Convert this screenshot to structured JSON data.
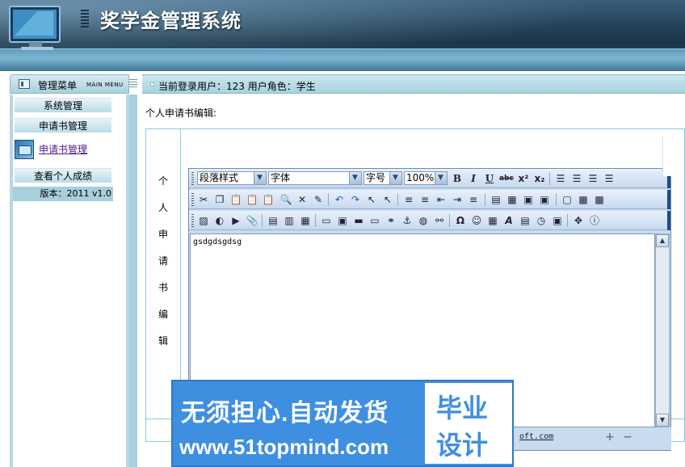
{
  "app": {
    "title": "奖学金管理系统"
  },
  "menu": {
    "title": "管理菜单",
    "title_en": "MAIN MENU"
  },
  "status": {
    "text": "当前登录用户：123   用户角色：学生"
  },
  "sidebar": {
    "items": [
      {
        "label": "系统管理"
      },
      {
        "label": "申请书管理"
      },
      {
        "label": "申请书管理"
      },
      {
        "label": "查看个人成绩"
      }
    ],
    "version": "版本：2011 v1.0"
  },
  "main": {
    "section_title": "个人申请书编辑:",
    "vertical_label": [
      "个",
      "人",
      "申",
      "请",
      "书",
      "编",
      "辑"
    ]
  },
  "editor": {
    "format_select": "段落样式",
    "font_select": "字体",
    "size_select": "字号",
    "zoom_select": "100%",
    "content": "gsdgdsgdsg",
    "credit": "oft.com"
  },
  "watermark": {
    "line1": "无须担心.自动发货",
    "line2": "www.51topmind.com",
    "right1": "毕业",
    "right2": "设计"
  },
  "colors": {
    "accent": "#3f8fe0",
    "header": "#254459",
    "sidebar": "#b7d7e2"
  }
}
